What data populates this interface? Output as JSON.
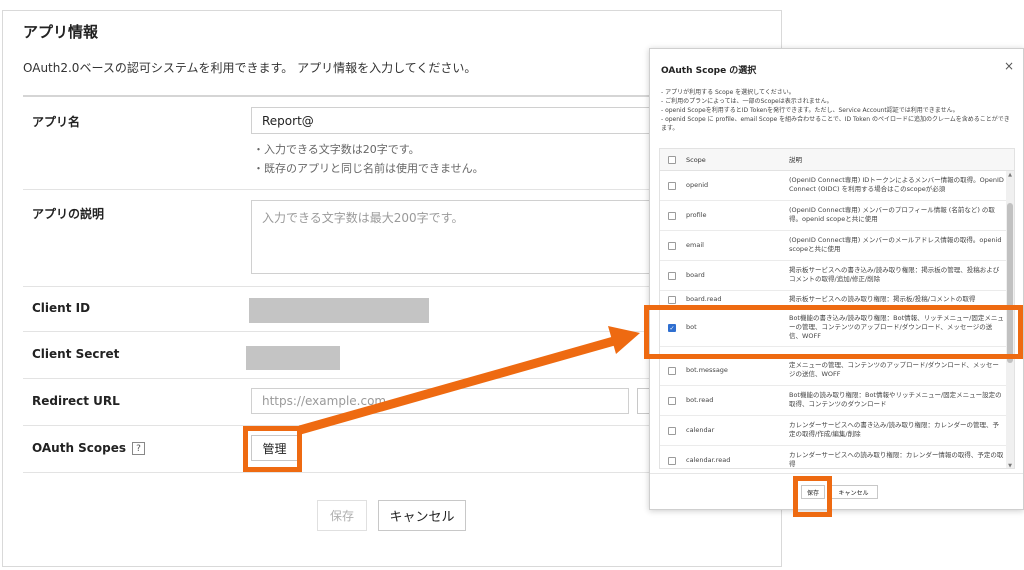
{
  "page": {
    "title": "アプリ情報",
    "description": "OAuth2.0ベースの認可システムを利用できます。 アプリ情報を入力してください。"
  },
  "form": {
    "app_name_label": "アプリ名",
    "app_name_value": "Report@",
    "app_name_hint1": "・入力できる文字数は20字です。",
    "app_name_hint2": "・既存のアプリと同じ名前は使用できません。",
    "app_desc_label": "アプリの説明",
    "app_desc_placeholder": "入力できる文字数は最大200字です。",
    "client_id_label": "Client ID",
    "client_secret_label": "Client Secret",
    "redirect_label": "Redirect URL",
    "redirect_placeholder": "https://example.com",
    "oauth_label": "OAuth Scopes",
    "help_icon": "?",
    "manage_button": "管理",
    "save_button": "保存",
    "cancel_button": "キャンセル"
  },
  "modal": {
    "title": "OAuth Scope の選択",
    "close_icon": "×",
    "desc": [
      "- アプリが利用する Scope を選択してください。",
      "- ご利用のプランによっては、一部のScopeは表示されません。",
      "- openid Scopeを利用するとID Tokenを発行できます。ただし、Service Account認証では利用できません。",
      "- openid Scope に profile、email Scope を組み合わせることで、ID Token のペイロードに追加のクレームを含めることができます。"
    ],
    "col_scope": "Scope",
    "col_desc": "説明",
    "rows": [
      {
        "scope": "openid",
        "desc": "(OpenID Connect専用) IDトークンによるメンバー情報の取得。OpenID Connect (OIDC) を利用する場合はこのscopeが必須",
        "checked": false
      },
      {
        "scope": "profile",
        "desc": "(OpenID Connect専用) メンバーのプロフィール情報 (名前など) の取得。openid scopeと共に使用",
        "checked": false
      },
      {
        "scope": "email",
        "desc": "(OpenID Connect専用) メンバーのメールアドレス情報の取得。openid scopeと共に使用",
        "checked": false
      },
      {
        "scope": "board",
        "desc": "掲示板サービスへの書き込み/読み取り権限：掲示板の管理、投稿およびコメントの取得/追加/修正/削除",
        "checked": false
      },
      {
        "scope": "board.read",
        "desc": "掲示板サービスへの読み取り権限：掲示板/投稿/コメントの取得",
        "checked": false
      },
      {
        "scope": "bot",
        "desc": "Bot機能の書き込み/読み取り権限：Bot情報、リッチメニュー/固定メニューの管理、コンテンツのアップロード/ダウンロード、メッセージの送信、WOFF",
        "checked": true
      },
      {
        "scope": "bot.message",
        "desc": "定メニューの管理、コンテンツのアップロード/ダウンロード、メッセージの送信、WOFF",
        "checked": false
      },
      {
        "scope": "bot.read",
        "desc": "Bot機能の読み取り権限：Bot情報やリッチメニュー/固定メニュー設定の取得、コンテンツのダウンロード",
        "checked": false
      },
      {
        "scope": "calendar",
        "desc": "カレンダーサービスへの書き込み/読み取り権限：カレンダーの管理、予定の取得/作成/編集/削除",
        "checked": false
      },
      {
        "scope": "calendar.read",
        "desc": "カレンダーサービスへの読み取り権限：カレンダー情報の取得、予定の取得",
        "checked": false
      }
    ],
    "save_button": "保存",
    "cancel_button": "キャンセル",
    "check_mark": "✓"
  },
  "colors": {
    "highlight": "#ee6a11",
    "checkbox": "#2f6fd0"
  }
}
